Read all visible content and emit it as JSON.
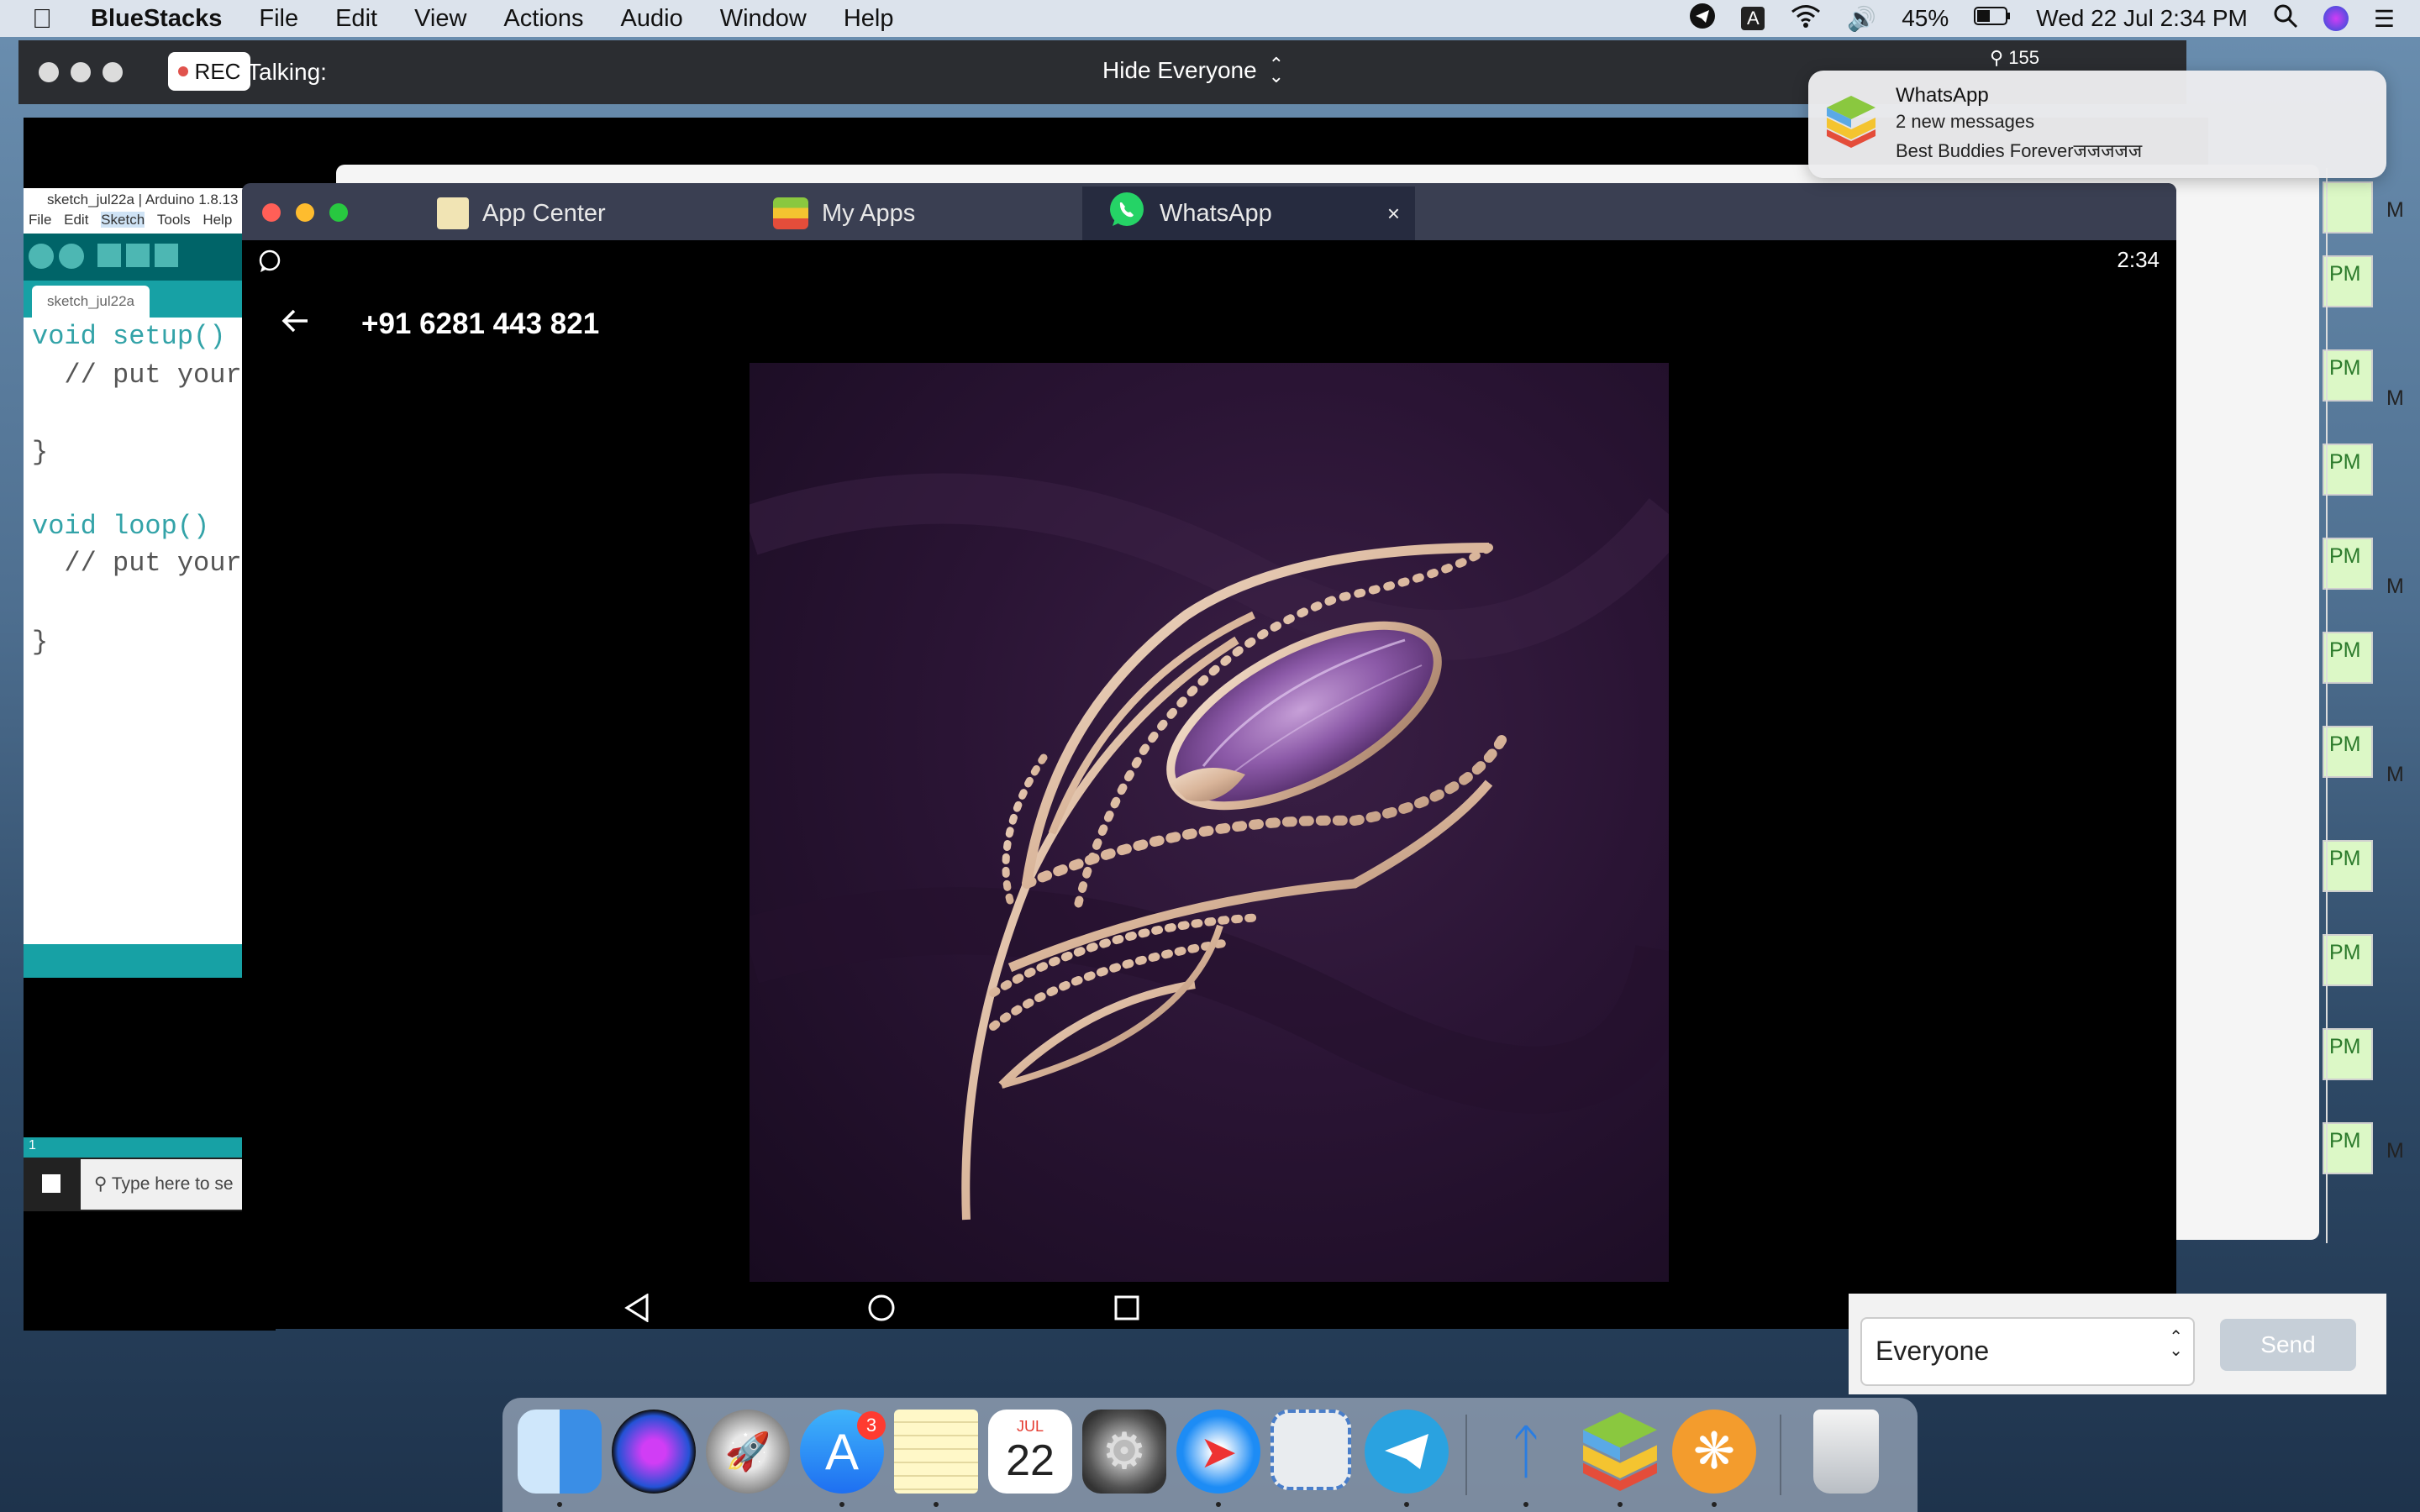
{
  "menubar": {
    "app_name": "BlueStacks",
    "items": [
      "File",
      "Edit",
      "View",
      "Actions",
      "Audio",
      "Window",
      "Help"
    ],
    "battery": "45%",
    "clock": "Wed 22 Jul  2:34 PM"
  },
  "bluestacks_bar": {
    "rec_label": "REC",
    "talking_label": "Talking:",
    "visibility": "Hide Everyone",
    "count": "155"
  },
  "notification": {
    "app": "WhatsApp",
    "title": "2 new messages",
    "body": "Best Buddies Foreverजजजजज"
  },
  "arduino": {
    "window_title": "sketch_jul22a | Arduino 1.8.13",
    "menu": [
      "File",
      "Edit",
      "Sketch",
      "Tools",
      "Help"
    ],
    "tab": "sketch_jul22a",
    "code_lines": [
      "void setup()",
      "  // put your",
      "",
      "}",
      "",
      "void loop()",
      "  // put your",
      "",
      "}"
    ],
    "console_line": "1",
    "search_placeholder": "Type here to se"
  },
  "tabs": {
    "app_center": "App Center",
    "my_apps": "My Apps",
    "whatsapp": "WhatsApp"
  },
  "whatsapp": {
    "time": "2:34",
    "contact": "+91 6281 443 821"
  },
  "whatsapp_web": {
    "bubble_times": [
      "",
      "PM",
      "PM",
      "PM",
      "PM",
      "PM",
      "PM",
      "PM",
      "PM",
      "PM",
      "PM"
    ],
    "edge_letters": [
      "M",
      "M",
      "M",
      "M",
      "M"
    ]
  },
  "send_area": {
    "audience": "Everyone",
    "send_label": "Send"
  },
  "dock": {
    "appstore_badge": "3",
    "calendar_month": "JUL",
    "calendar_day": "22"
  },
  "colors": {
    "bubble_green": "#dcf8c6",
    "bluestacks_tab_bg": "#3a3f52",
    "arduino_teal": "#17a1a5",
    "whatsapp_green": "#25d366"
  }
}
